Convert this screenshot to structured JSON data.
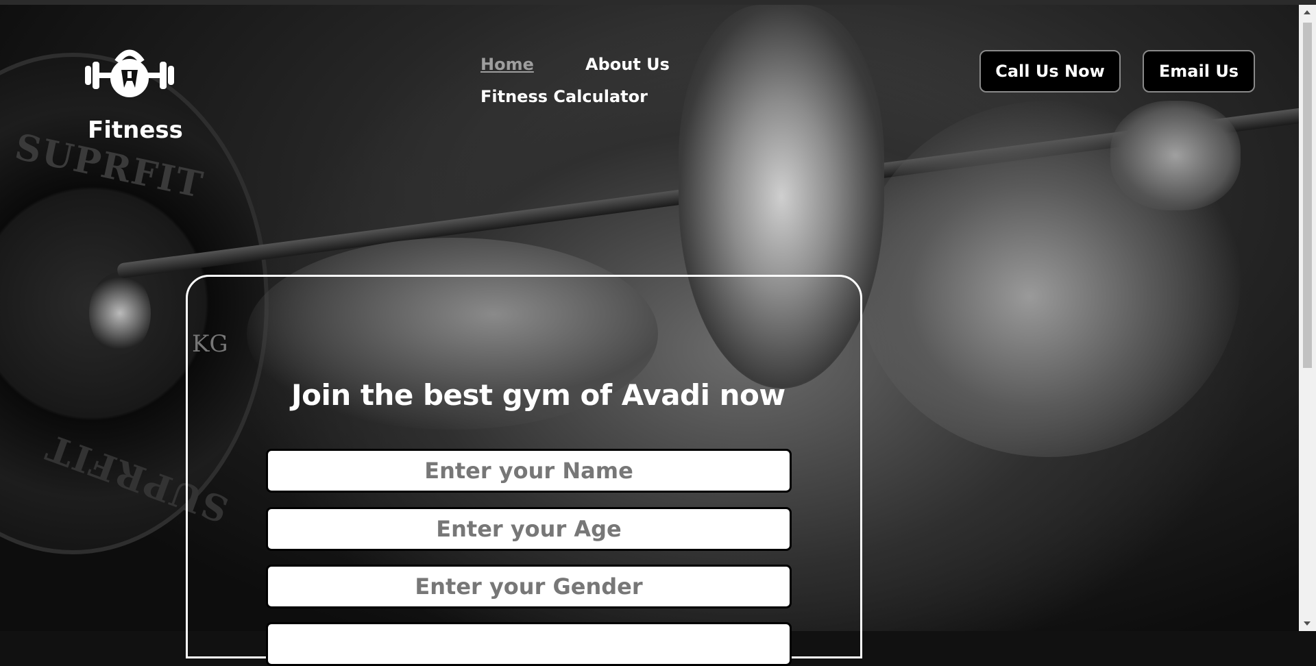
{
  "brand": {
    "name": "Fitness",
    "logo_icon": "kettlebell-barbell-icon"
  },
  "nav": {
    "home": "Home",
    "about": "About Us",
    "calculator": "Fitness Calculator"
  },
  "actions": {
    "call": "Call Us Now",
    "email": "Email Us"
  },
  "form": {
    "title": "Join the best gym of Avadi now",
    "fields": [
      {
        "placeholder": "Enter your Name"
      },
      {
        "placeholder": "Enter your Age"
      },
      {
        "placeholder": "Enter your Gender"
      }
    ]
  },
  "colors": {
    "background": "#111111",
    "accent": "#ffffff",
    "active_nav": "#9e9e9e",
    "button_border": "#8a8a8a"
  }
}
